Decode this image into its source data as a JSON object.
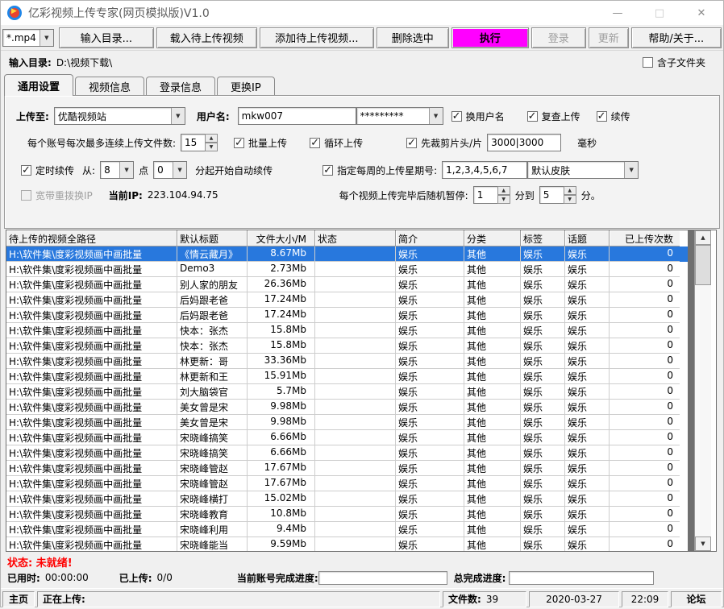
{
  "colors": {
    "accent": "#ff00ff",
    "selection": "#2878dd",
    "status_red": "#ff0000"
  },
  "window": {
    "title": "亿彩视频上传专家(网页模拟版)V1.0",
    "minimize": "—",
    "maximize": "□",
    "close": "✕"
  },
  "toolbar": {
    "file_filter": "*.mp4",
    "buttons": [
      {
        "label": "输入目录...",
        "state": "normal"
      },
      {
        "label": "载入待上传视频",
        "state": "normal"
      },
      {
        "label": "添加待上传视频...",
        "state": "normal"
      },
      {
        "label": "删除选中",
        "state": "normal"
      },
      {
        "label": "执行",
        "state": "accent"
      },
      {
        "label": "登录",
        "state": "disabled"
      },
      {
        "label": "更新",
        "state": "disabled"
      },
      {
        "label": "帮助/关于...",
        "state": "normal"
      }
    ]
  },
  "directory_row": {
    "label": "输入目录:",
    "value": "D:\\视频下载\\",
    "subfolder_label": "含子文件夹",
    "subfolder_checked": false
  },
  "tabs": [
    {
      "label": "通用设置",
      "active": true
    },
    {
      "label": "视频信息",
      "active": false
    },
    {
      "label": "登录信息",
      "active": false
    },
    {
      "label": "更换IP",
      "active": false
    }
  ],
  "settings": {
    "upload_to_label": "上传至:",
    "upload_to_value": "优酷视频站",
    "username_label": "用户名:",
    "username_value": "mkw007",
    "password_value": "*********",
    "checkbox_change_user": "换用户名",
    "checkbox_recheck": "复查上传",
    "checkbox_resume": "续传",
    "max_files_label": "每个账号每次最多连续上传文件数:",
    "max_files_value": "15",
    "checkbox_batch": "批量上传",
    "checkbox_loop": "循环上传",
    "checkbox_trim": "先裁剪片头/片",
    "trim_value": "3000|3000",
    "trim_unit": "毫秒",
    "checkbox_schedule": "定时续传",
    "schedule_from_label": "从:",
    "schedule_hour": "8",
    "schedule_hour_suffix": "点",
    "schedule_minute": "0",
    "schedule_suffix": "分起开始自动续传",
    "checkbox_weekday": "指定每周的上传星期号:",
    "weekday_value": "1,2,3,4,5,6,7",
    "skin_value": "默认皮肤",
    "checkbox_redial": "宽带重拨换IP",
    "current_ip_label": "当前IP:",
    "current_ip_value": "223.104.94.75",
    "pause_label": "每个视频上传完毕后随机暂停:",
    "pause_min": "1",
    "pause_mid": "分到",
    "pause_max": "5",
    "pause_suffix": "分。"
  },
  "table": {
    "columns": [
      "待上传的视频全路径",
      "默认标题",
      "文件大小/M",
      "状态",
      "简介",
      "分类",
      "标签",
      "话题",
      "已上传次数"
    ],
    "rows": [
      {
        "path": "H:\\软件集\\度彩视频画中画批量",
        "title": "《情云藏月》",
        "size": "8.67Mb",
        "status": "",
        "intro": "娱乐",
        "category": "其他",
        "tag": "娱乐",
        "topic": "娱乐",
        "count": "0",
        "selected": true
      },
      {
        "path": "H:\\软件集\\度彩视频画中画批量",
        "title": "Demo3",
        "size": "2.73Mb",
        "status": "",
        "intro": "娱乐",
        "category": "其他",
        "tag": "娱乐",
        "topic": "娱乐",
        "count": "0",
        "selected": false
      },
      {
        "path": "H:\\软件集\\度彩视频画中画批量",
        "title": "别人家的朋友",
        "size": "26.36Mb",
        "status": "",
        "intro": "娱乐",
        "category": "其他",
        "tag": "娱乐",
        "topic": "娱乐",
        "count": "0",
        "selected": false
      },
      {
        "path": "H:\\软件集\\度彩视频画中画批量",
        "title": "后妈跟老爸",
        "size": "17.24Mb",
        "status": "",
        "intro": "娱乐",
        "category": "其他",
        "tag": "娱乐",
        "topic": "娱乐",
        "count": "0",
        "selected": false
      },
      {
        "path": "H:\\软件集\\度彩视频画中画批量",
        "title": "后妈跟老爸",
        "size": "17.24Mb",
        "status": "",
        "intro": "娱乐",
        "category": "其他",
        "tag": "娱乐",
        "topic": "娱乐",
        "count": "0",
        "selected": false
      },
      {
        "path": "H:\\软件集\\度彩视频画中画批量",
        "title": "快本：张杰",
        "size": "15.8Mb",
        "status": "",
        "intro": "娱乐",
        "category": "其他",
        "tag": "娱乐",
        "topic": "娱乐",
        "count": "0",
        "selected": false
      },
      {
        "path": "H:\\软件集\\度彩视频画中画批量",
        "title": "快本：张杰",
        "size": "15.8Mb",
        "status": "",
        "intro": "娱乐",
        "category": "其他",
        "tag": "娱乐",
        "topic": "娱乐",
        "count": "0",
        "selected": false
      },
      {
        "path": "H:\\软件集\\度彩视频画中画批量",
        "title": "林更新：哥",
        "size": "33.36Mb",
        "status": "",
        "intro": "娱乐",
        "category": "其他",
        "tag": "娱乐",
        "topic": "娱乐",
        "count": "0",
        "selected": false
      },
      {
        "path": "H:\\软件集\\度彩视频画中画批量",
        "title": "林更新和王",
        "size": "15.91Mb",
        "status": "",
        "intro": "娱乐",
        "category": "其他",
        "tag": "娱乐",
        "topic": "娱乐",
        "count": "0",
        "selected": false
      },
      {
        "path": "H:\\软件集\\度彩视频画中画批量",
        "title": "刘大脑袋官",
        "size": "5.7Mb",
        "status": "",
        "intro": "娱乐",
        "category": "其他",
        "tag": "娱乐",
        "topic": "娱乐",
        "count": "0",
        "selected": false
      },
      {
        "path": "H:\\软件集\\度彩视频画中画批量",
        "title": "美女曾是宋",
        "size": "9.98Mb",
        "status": "",
        "intro": "娱乐",
        "category": "其他",
        "tag": "娱乐",
        "topic": "娱乐",
        "count": "0",
        "selected": false
      },
      {
        "path": "H:\\软件集\\度彩视频画中画批量",
        "title": "美女曾是宋",
        "size": "9.98Mb",
        "status": "",
        "intro": "娱乐",
        "category": "其他",
        "tag": "娱乐",
        "topic": "娱乐",
        "count": "0",
        "selected": false
      },
      {
        "path": "H:\\软件集\\度彩视频画中画批量",
        "title": "宋晓峰搞笑",
        "size": "6.66Mb",
        "status": "",
        "intro": "娱乐",
        "category": "其他",
        "tag": "娱乐",
        "topic": "娱乐",
        "count": "0",
        "selected": false
      },
      {
        "path": "H:\\软件集\\度彩视频画中画批量",
        "title": "宋晓峰搞笑",
        "size": "6.66Mb",
        "status": "",
        "intro": "娱乐",
        "category": "其他",
        "tag": "娱乐",
        "topic": "娱乐",
        "count": "0",
        "selected": false
      },
      {
        "path": "H:\\软件集\\度彩视频画中画批量",
        "title": "宋晓峰管赵",
        "size": "17.67Mb",
        "status": "",
        "intro": "娱乐",
        "category": "其他",
        "tag": "娱乐",
        "topic": "娱乐",
        "count": "0",
        "selected": false
      },
      {
        "path": "H:\\软件集\\度彩视频画中画批量",
        "title": "宋晓峰管赵",
        "size": "17.67Mb",
        "status": "",
        "intro": "娱乐",
        "category": "其他",
        "tag": "娱乐",
        "topic": "娱乐",
        "count": "0",
        "selected": false
      },
      {
        "path": "H:\\软件集\\度彩视频画中画批量",
        "title": "宋晓峰横打",
        "size": "15.02Mb",
        "status": "",
        "intro": "娱乐",
        "category": "其他",
        "tag": "娱乐",
        "topic": "娱乐",
        "count": "0",
        "selected": false
      },
      {
        "path": "H:\\软件集\\度彩视频画中画批量",
        "title": "宋晓峰教育",
        "size": "10.8Mb",
        "status": "",
        "intro": "娱乐",
        "category": "其他",
        "tag": "娱乐",
        "topic": "娱乐",
        "count": "0",
        "selected": false
      },
      {
        "path": "H:\\软件集\\度彩视频画中画批量",
        "title": "宋晓峰利用",
        "size": "9.4Mb",
        "status": "",
        "intro": "娱乐",
        "category": "其他",
        "tag": "娱乐",
        "topic": "娱乐",
        "count": "0",
        "selected": false
      },
      {
        "path": "H:\\软件集\\度彩视频画中画批量",
        "title": "宋晓峰能当",
        "size": "9.59Mb",
        "status": "",
        "intro": "娱乐",
        "category": "其他",
        "tag": "娱乐",
        "topic": "娱乐",
        "count": "0",
        "selected": false
      }
    ]
  },
  "status_panel": {
    "status_label": "状态:",
    "status_value": "未就绪!",
    "elapsed_label": "已用时:",
    "elapsed_value": "00:00:00",
    "uploaded_label": "已上传:",
    "uploaded_value": "0/0",
    "account_progress_label": "当前账号完成进度:",
    "total_progress_label": "总完成进度:"
  },
  "statusbar": {
    "home": "主页",
    "uploading_label": "正在上传:",
    "file_count_label": "文件数:",
    "file_count_value": "39",
    "date": "2020-03-27",
    "time": "22:09",
    "forum": "论坛"
  }
}
